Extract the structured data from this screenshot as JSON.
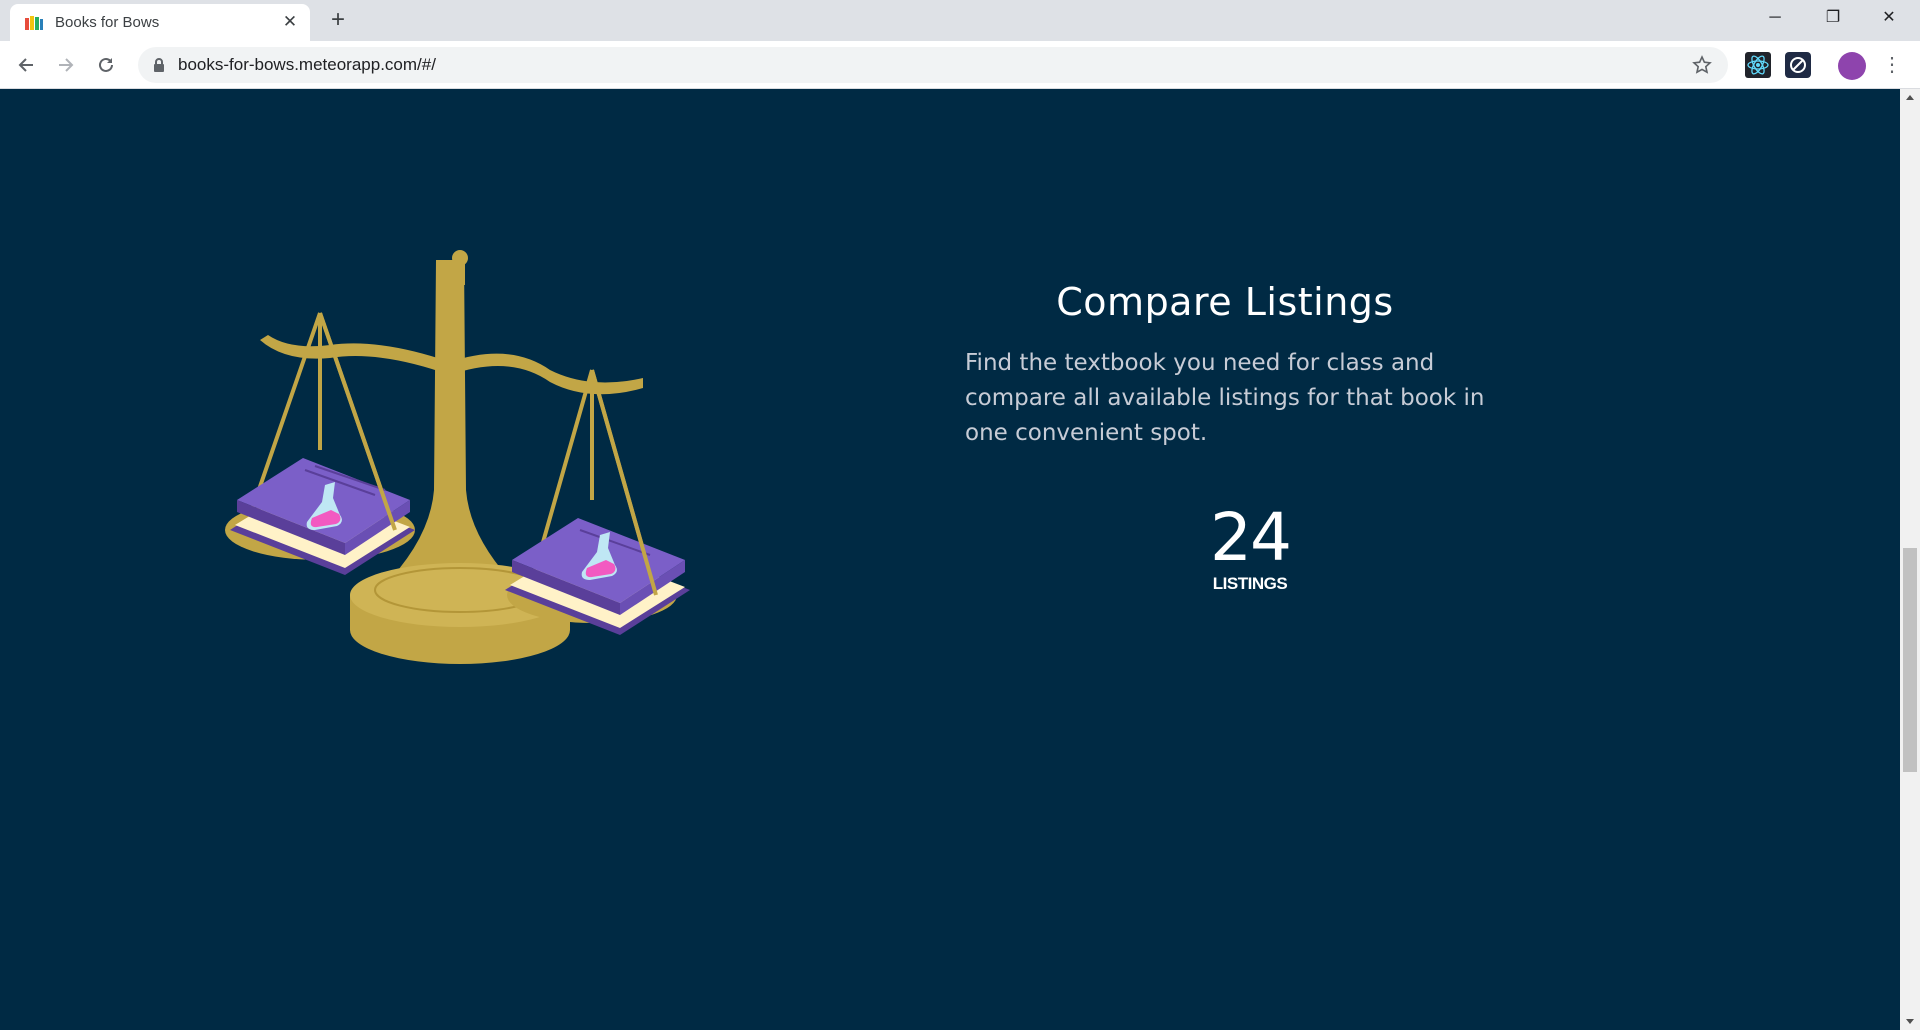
{
  "browser": {
    "tab_title": "Books for Bows",
    "new_tab_symbol": "+",
    "tab_close_symbol": "✕",
    "url": "books-for-bows.meteorapp.com/#/",
    "icons": {
      "back": "arrow-left-icon",
      "forward": "arrow-right-icon",
      "reload": "reload-icon",
      "lock": "lock-icon",
      "bookmark": "star-icon",
      "extension_1": "react-icon",
      "extension_2": "extension-icon",
      "profile": "avatar",
      "menu": "more-vert-icon"
    },
    "window_controls": {
      "minimize": "─",
      "restore": "❐",
      "close": "✕"
    }
  },
  "page": {
    "background_color": "#002a44",
    "accent_gold": "#c2a646",
    "book_purple": "#7b5fc8",
    "feature": {
      "title": "Compare Listings",
      "description": "Find the textbook you need for class and compare all available listings for that book in one convenient spot."
    },
    "stat": {
      "number": "24",
      "label": "LISTINGS"
    }
  }
}
